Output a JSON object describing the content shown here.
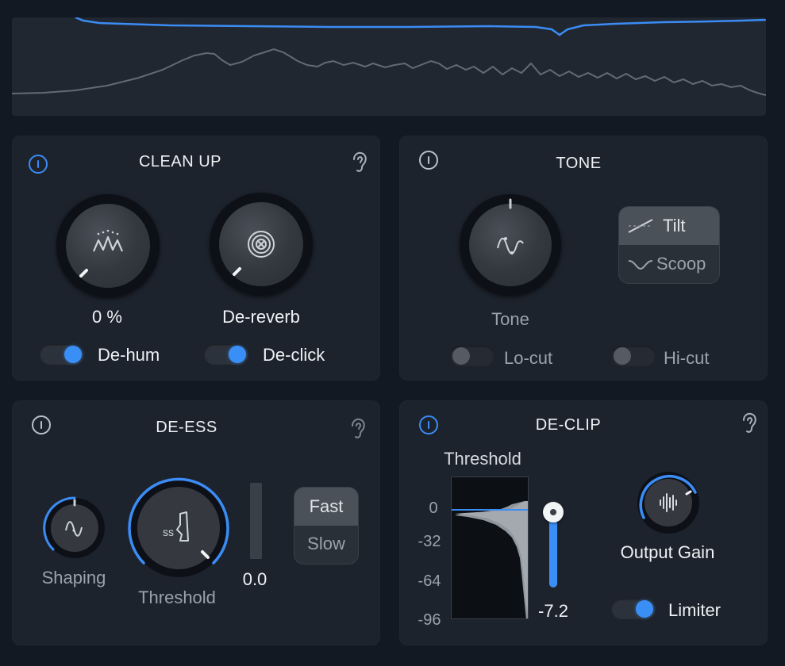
{
  "cleanup": {
    "title": "CLEAN UP",
    "knob1_value": "0 %",
    "knob2_label": "De-reverb",
    "toggle1_label": "De-hum",
    "toggle2_label": "De-click"
  },
  "tone": {
    "title": "TONE",
    "knob_label": "Tone",
    "seg_tilt": "Tilt",
    "seg_scoop": "Scoop",
    "locut_label": "Lo-cut",
    "hicut_label": "Hi-cut"
  },
  "deess": {
    "title": "DE-ESS",
    "shaping_label": "Shaping",
    "threshold_label": "Threshold",
    "meter_value": "0.0",
    "seg_fast": "Fast",
    "seg_slow": "Slow"
  },
  "declip": {
    "title": "DE-CLIP",
    "threshold_label": "Threshold",
    "scale": [
      "0",
      "-32",
      "-64",
      "-96"
    ],
    "slider_value": "-7.2",
    "output_gain_label": "Output Gain",
    "limiter_label": "Limiter"
  },
  "colors": {
    "accent": "#3b8cf5",
    "panel": "#1d232d",
    "background": "#131923"
  }
}
